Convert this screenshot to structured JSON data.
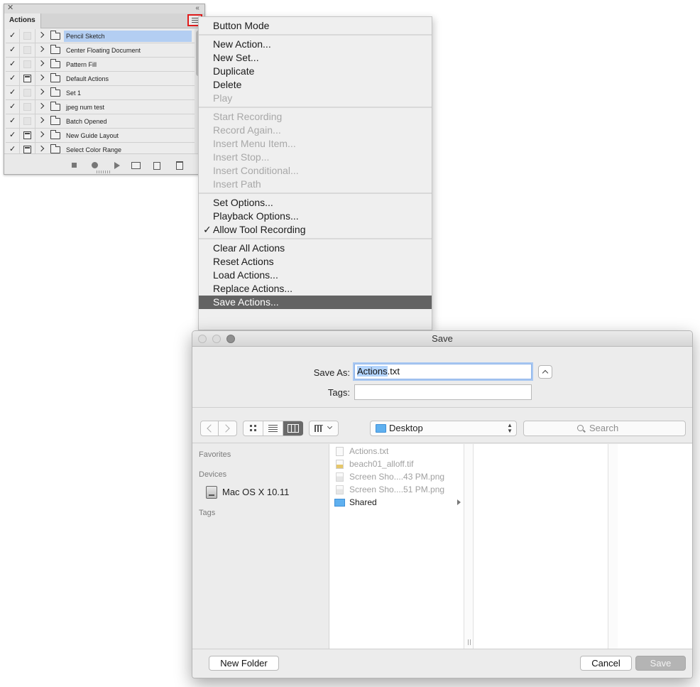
{
  "actions_panel": {
    "close_glyph": "✕",
    "collapse_glyph": "‹‹",
    "tab_label": "Actions",
    "items": [
      {
        "name": "Pencil Sketch",
        "checked": true,
        "toggle": false,
        "selected": true
      },
      {
        "name": "Center Floating Document",
        "checked": true,
        "toggle": false
      },
      {
        "name": "Pattern Fill",
        "checked": true,
        "toggle": false
      },
      {
        "name": "Default Actions",
        "checked": true,
        "toggle": true
      },
      {
        "name": "Set 1",
        "checked": true,
        "toggle": false
      },
      {
        "name": "jpeg num test",
        "checked": true,
        "toggle": false
      },
      {
        "name": "Batch Opened",
        "checked": true,
        "toggle": false
      },
      {
        "name": "New Guide Layout",
        "checked": true,
        "toggle": true
      },
      {
        "name": "Select Color Range",
        "checked": true,
        "toggle": true
      }
    ],
    "footer_icons": [
      "stop-icon",
      "record-icon",
      "play-icon",
      "new-set-folder-icon",
      "new-action-icon",
      "trash-icon"
    ]
  },
  "flyout_menu": {
    "groups": [
      [
        {
          "label": "Button Mode"
        }
      ],
      [
        {
          "label": "New Action..."
        },
        {
          "label": "New Set..."
        },
        {
          "label": "Duplicate"
        },
        {
          "label": "Delete"
        },
        {
          "label": "Play",
          "disabled": true
        }
      ],
      [
        {
          "label": "Start Recording",
          "disabled": true
        },
        {
          "label": "Record Again...",
          "disabled": true
        },
        {
          "label": "Insert Menu Item...",
          "disabled": true
        },
        {
          "label": "Insert Stop...",
          "disabled": true
        },
        {
          "label": "Insert Conditional...",
          "disabled": true
        },
        {
          "label": "Insert Path",
          "disabled": true
        }
      ],
      [
        {
          "label": "Set Options..."
        },
        {
          "label": "Playback Options..."
        },
        {
          "label": "Allow Tool Recording",
          "checked": true
        }
      ],
      [
        {
          "label": "Clear All Actions"
        },
        {
          "label": "Reset Actions"
        },
        {
          "label": "Load Actions..."
        },
        {
          "label": "Replace Actions..."
        },
        {
          "label": "Save Actions...",
          "highlighted": true
        }
      ]
    ],
    "check_glyph": "✓"
  },
  "save_dialog": {
    "title": "Save",
    "save_as_label": "Save As:",
    "filename_selected": "Actions",
    "filename_rest": ".txt",
    "tags_label": "Tags:",
    "tags_value": "",
    "location": "Desktop",
    "search_placeholder": "Search",
    "sidebar": {
      "favorites": "Favorites",
      "devices": "Devices",
      "device_item": "Mac OS X 10.11",
      "tags": "Tags"
    },
    "files": [
      {
        "name": "Actions.txt",
        "icon": "txt",
        "enabled": false
      },
      {
        "name": "beach01_alloff.tif",
        "icon": "tif",
        "enabled": false
      },
      {
        "name": "Screen Sho....43 PM.png",
        "icon": "png",
        "enabled": false
      },
      {
        "name": "Screen Sho....51 PM.png",
        "icon": "png",
        "enabled": false
      },
      {
        "name": "Shared",
        "icon": "folder",
        "enabled": true,
        "has_children": true
      }
    ],
    "buttons": {
      "new_folder": "New Folder",
      "cancel": "Cancel",
      "save": "Save"
    }
  }
}
